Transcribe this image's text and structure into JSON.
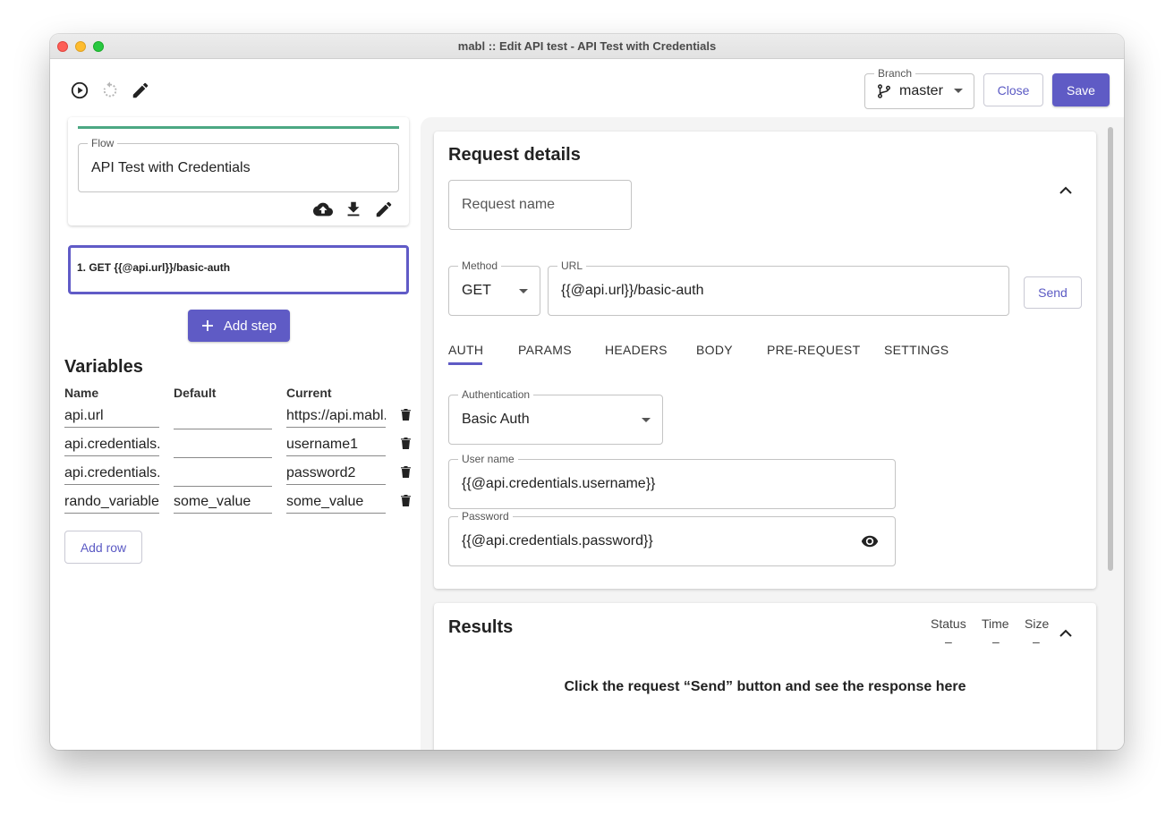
{
  "window": {
    "title": "mabl ::  Edit API test - API Test with Credentials"
  },
  "toolbar": {
    "branch_label": "Branch",
    "branch_value": "master",
    "close_label": "Close",
    "save_label": "Save"
  },
  "flow": {
    "label": "Flow",
    "value": "API Test with Credentials"
  },
  "steps": [
    {
      "label": "1. GET {{@api.url}}/basic-auth"
    }
  ],
  "add_step_label": "Add step",
  "variables": {
    "title": "Variables",
    "columns": [
      "Name",
      "Default",
      "Current"
    ],
    "rows": [
      {
        "name": "api.url",
        "default": "",
        "current": "https://api.mabl.com"
      },
      {
        "name": "api.credentials.username",
        "default": "",
        "current": "username1"
      },
      {
        "name": "api.credentials.password",
        "default": "",
        "current": "password2"
      },
      {
        "name": "rando_variable",
        "default": "some_value",
        "current": "some_value"
      }
    ],
    "add_row_label": "Add row"
  },
  "request": {
    "title": "Request details",
    "name_placeholder": "Request name",
    "method_label": "Method",
    "method_value": "GET",
    "url_label": "URL",
    "url_value": "{{@api.url}}/basic-auth",
    "send_label": "Send",
    "tabs": [
      "AUTH",
      "PARAMS",
      "HEADERS",
      "BODY",
      "PRE-REQUEST",
      "SETTINGS"
    ],
    "auth": {
      "type_label": "Authentication",
      "type_value": "Basic Auth",
      "username_label": "User name",
      "username_value": "{{@api.credentials.username}}",
      "password_label": "Password",
      "password_value": "{{@api.credentials.password}}"
    }
  },
  "results": {
    "title": "Results",
    "status_label": "Status",
    "status_value": "–",
    "time_label": "Time",
    "time_value": "–",
    "size_label": "Size",
    "size_value": "–",
    "empty_message": "Click the request “Send” button and see the response here"
  },
  "colors": {
    "accent": "#5f5bc5",
    "flow_bar": "#4ca883"
  }
}
